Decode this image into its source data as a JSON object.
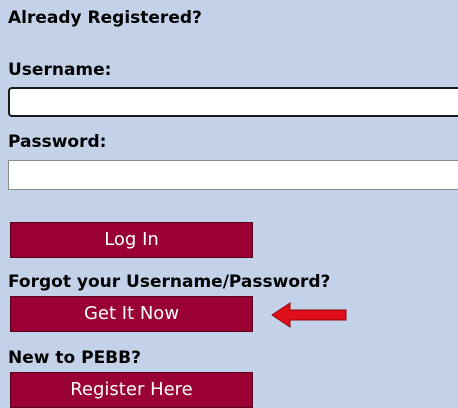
{
  "login": {
    "heading": "Already Registered?",
    "username_label": "Username:",
    "username_value": "",
    "password_label": "Password:",
    "password_value": "",
    "login_button": "Log In",
    "forgot_label": "Forgot your Username/Password?",
    "get_it_now_button": "Get It Now",
    "new_label": "New to PEBB?",
    "register_button": "Register Here"
  },
  "colors": {
    "background": "#c3d2e8",
    "button": "#990033",
    "arrow": "#e0101a"
  },
  "icons": {
    "annotation": "left-arrow-icon"
  }
}
